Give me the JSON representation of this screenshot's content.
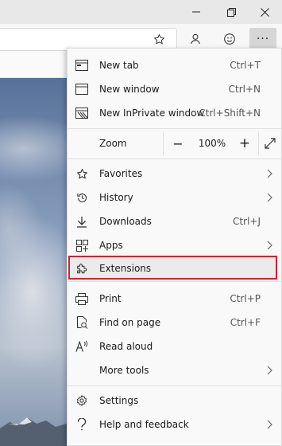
{
  "window": {
    "minimize_icon": "minimize-icon",
    "restore_icon": "restore-icon",
    "close_icon": "close-icon"
  },
  "toolbar": {
    "favorite_icon": "star-outline-icon",
    "profile_icon": "person-icon",
    "feedback_icon": "smiley-icon",
    "more_label": "···"
  },
  "menu": {
    "items": [
      {
        "id": "new-tab",
        "label": "New tab",
        "shortcut": "Ctrl+T",
        "icon": "new-tab-icon"
      },
      {
        "id": "new-window",
        "label": "New window",
        "shortcut": "Ctrl+N",
        "icon": "new-window-icon"
      },
      {
        "id": "inprivate",
        "label": "New InPrivate window",
        "shortcut": "Ctrl+Shift+N",
        "icon": "inprivate-icon"
      }
    ],
    "zoom": {
      "label": "Zoom",
      "minus": "−",
      "value": "100%",
      "plus": "+"
    },
    "nav": [
      {
        "id": "favorites",
        "label": "Favorites",
        "shortcut": "",
        "icon": "star-icon",
        "submenu": true
      },
      {
        "id": "history",
        "label": "History",
        "shortcut": "",
        "icon": "history-icon",
        "submenu": true
      },
      {
        "id": "downloads",
        "label": "Downloads",
        "shortcut": "Ctrl+J",
        "icon": "download-icon",
        "submenu": false
      },
      {
        "id": "apps",
        "label": "Apps",
        "shortcut": "",
        "icon": "apps-icon",
        "submenu": true
      },
      {
        "id": "extensions",
        "label": "Extensions",
        "shortcut": "",
        "icon": "puzzle-icon",
        "submenu": false
      }
    ],
    "tools": [
      {
        "id": "print",
        "label": "Print",
        "shortcut": "Ctrl+P",
        "icon": "printer-icon"
      },
      {
        "id": "find",
        "label": "Find on page",
        "shortcut": "Ctrl+F",
        "icon": "find-icon"
      },
      {
        "id": "read-aloud",
        "label": "Read aloud",
        "shortcut": "",
        "icon": "read-aloud-icon"
      },
      {
        "id": "more-tools",
        "label": "More tools",
        "shortcut": "",
        "icon": "",
        "submenu": true
      }
    ],
    "footer": [
      {
        "id": "settings",
        "label": "Settings",
        "icon": "gear-icon"
      },
      {
        "id": "help",
        "label": "Help and feedback",
        "icon": "question-icon",
        "submenu": true
      }
    ]
  },
  "colors": {
    "highlight_border": "#d9202a",
    "menu_bg": "#f9f9f9",
    "titlebar_bg": "#e8e8e8"
  }
}
